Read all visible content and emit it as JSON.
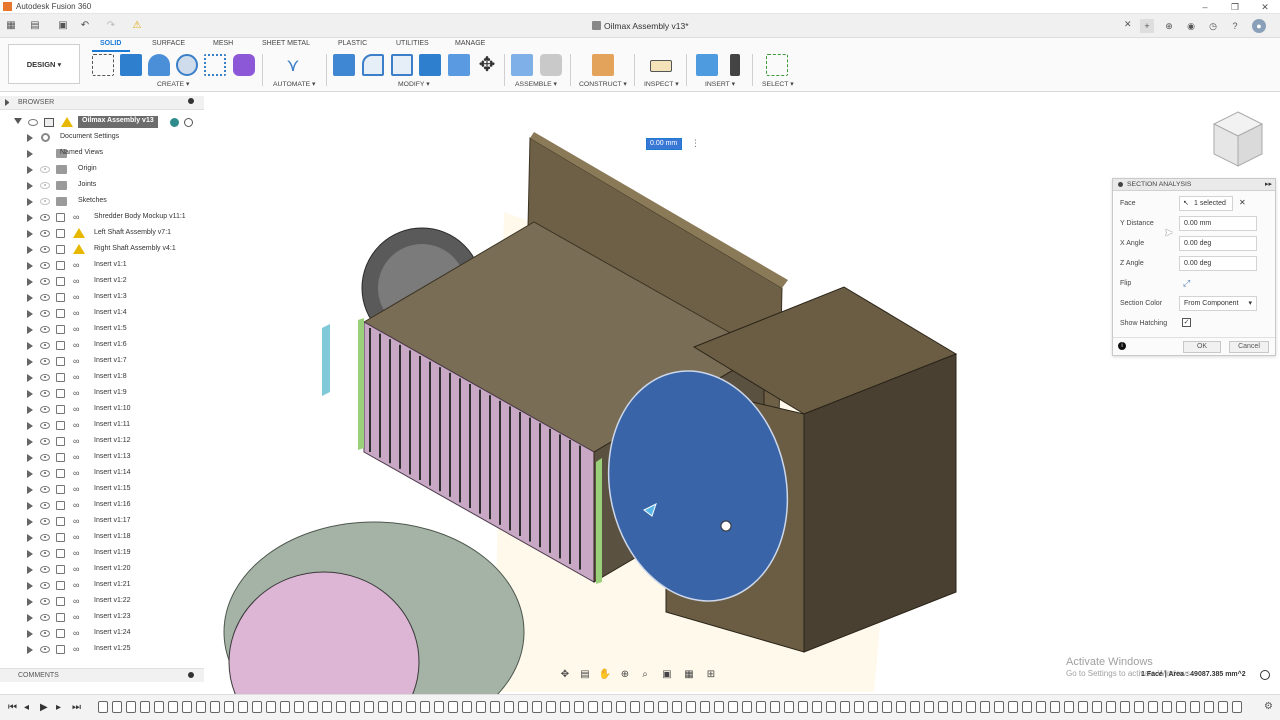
{
  "app": {
    "title": "Autodesk Fusion 360",
    "document": "Oilmax Assembly v13*"
  },
  "ribbon": {
    "workspace": "DESIGN ▾",
    "tabs": [
      "SOLID",
      "SURFACE",
      "MESH",
      "SHEET METAL",
      "PLASTIC",
      "UTILITIES",
      "MANAGE"
    ],
    "groups": [
      "CREATE ▾",
      "AUTOMATE ▾",
      "MODIFY ▾",
      "ASSEMBLE ▾",
      "CONSTRUCT ▾",
      "INSPECT ▾",
      "INSERT ▾",
      "SELECT ▾"
    ]
  },
  "browser": {
    "title": "BROWSER",
    "root": "Oilmax Assembly v13",
    "folders": [
      "Document Settings",
      "Named Views",
      "Origin",
      "Joints",
      "Sketches"
    ],
    "components": [
      "Shredder Body Mockup v11:1",
      "Left Shaft Assembly v7:1",
      "Right Shaft Assembly v4:1"
    ],
    "inserts": [
      "Insert v1:1",
      "Insert v1:2",
      "Insert v1:3",
      "Insert v1:4",
      "Insert v1:5",
      "Insert v1:6",
      "Insert v1:7",
      "Insert v1:8",
      "Insert v1:9",
      "Insert v1:10",
      "Insert v1:11",
      "Insert v1:12",
      "Insert v1:13",
      "Insert v1:14",
      "Insert v1:15",
      "Insert v1:16",
      "Insert v1:17",
      "Insert v1:18",
      "Insert v1:19",
      "Insert v1:20",
      "Insert v1:21",
      "Insert v1:22",
      "Insert v1:23",
      "Insert v1:24",
      "Insert v1:25"
    ]
  },
  "comments": {
    "title": "COMMENTS"
  },
  "viewport": {
    "distance_value": "0.00 mm"
  },
  "section_analysis": {
    "title": "SECTION ANALYSIS",
    "face_label": "Face",
    "face_value": "1 selected",
    "y_distance_label": "Y Distance",
    "y_distance_value": "0.00 mm",
    "x_angle_label": "X Angle",
    "x_angle_value": "0.00 deg",
    "z_angle_label": "Z Angle",
    "z_angle_value": "0.00 deg",
    "flip_label": "Flip",
    "section_color_label": "Section Color",
    "section_color_value": "From Component",
    "show_hatching_label": "Show Hatching",
    "ok_label": "OK",
    "cancel_label": "Cancel"
  },
  "status": {
    "selection": "1 Face | Area : 49087.385 mm^2"
  },
  "watermark": {
    "line1": "Activate Windows",
    "line2": "Go to Settings to activate Windows."
  },
  "colors": {
    "accent": "#1a7ad4",
    "section_face": "#3a64a8",
    "housing": "#6b5f46",
    "hatch_pink": "#e6a8d8"
  }
}
